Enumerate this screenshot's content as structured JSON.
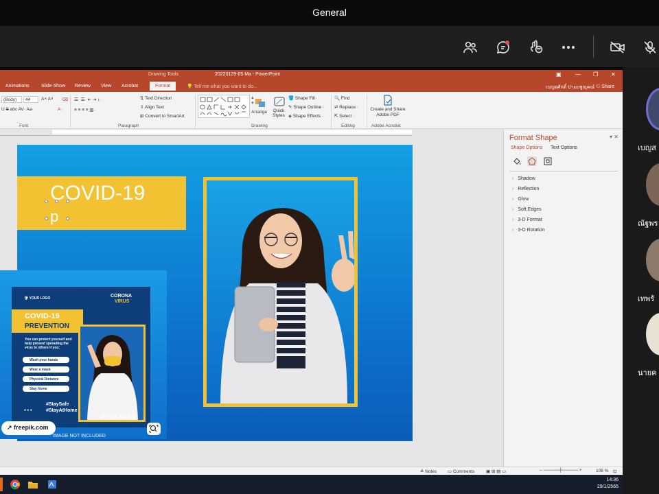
{
  "teams": {
    "title": "General",
    "participants": [
      {
        "name": "เบญส"
      },
      {
        "name": "ณัฐพร"
      },
      {
        "name": "เทพรั"
      },
      {
        "name": "นายค"
      }
    ]
  },
  "ppt": {
    "drawing_tools": "Drawing Tools",
    "file_title": "20220129-05 Ma - PowerPoint",
    "tabs": [
      "Animations",
      "Slide Show",
      "Review",
      "View",
      "Acrobat",
      "Format"
    ],
    "active_tab": "Format",
    "tell_me": "Tell me what you want to do...",
    "user": "เบญจศักดิ์ ป่ามะพูณุคณ์",
    "share": "Share",
    "ribbon": {
      "font_name": "(Body)",
      "font_size": "44",
      "text_direction": "Text Direction",
      "align_text": "Align Text",
      "convert_smartart": "Convert to SmartArt",
      "arrange": "Arrange",
      "quick_styles": "Quick Styles",
      "shape_fill": "Shape Fill",
      "shape_outline": "Shape Outline",
      "shape_effects": "Shape Effects",
      "find": "Find",
      "replace": "Replace",
      "select": "Select",
      "acrobat_btn": "Create and Share Adobe PDF",
      "groups": {
        "font": "Font",
        "paragraph": "Paragraph",
        "drawing": "Drawing",
        "editing": "Editing",
        "acrobat": "Adobe Acrobat"
      }
    },
    "slide": {
      "title": "COVID-19",
      "subtitle": "p"
    },
    "format_pane": {
      "title": "Format Shape",
      "tab_shape": "Shape Options",
      "tab_text": "Text Options",
      "sections": [
        "Shadow",
        "Reflection",
        "Glow",
        "Soft Edges",
        "3-D Format",
        "3-D Rotation"
      ]
    },
    "status": {
      "notes": "Notes",
      "comments": "Comments",
      "zoom": "106 %"
    }
  },
  "flyer": {
    "logo": "YOUR LOGO",
    "corona": "CORONA",
    "virus": "VIRUS",
    "title": "COVID-19",
    "subtitle": "PREVENTION",
    "body": "You can protect yourself and help prevent spreading the virus to others if you:",
    "bullets": [
      "Wash your hands",
      "Wear a mask",
      "Physical Distance",
      "Stay Home"
    ],
    "tags": [
      "#StaySafe",
      "#StayAtHome"
    ],
    "phone": "+123 456 789",
    "badge": "freepik.com",
    "note": "IMAGE NOT INCLUDED"
  },
  "taskbar": {
    "time": "14:36",
    "date": "29/1/2565"
  }
}
